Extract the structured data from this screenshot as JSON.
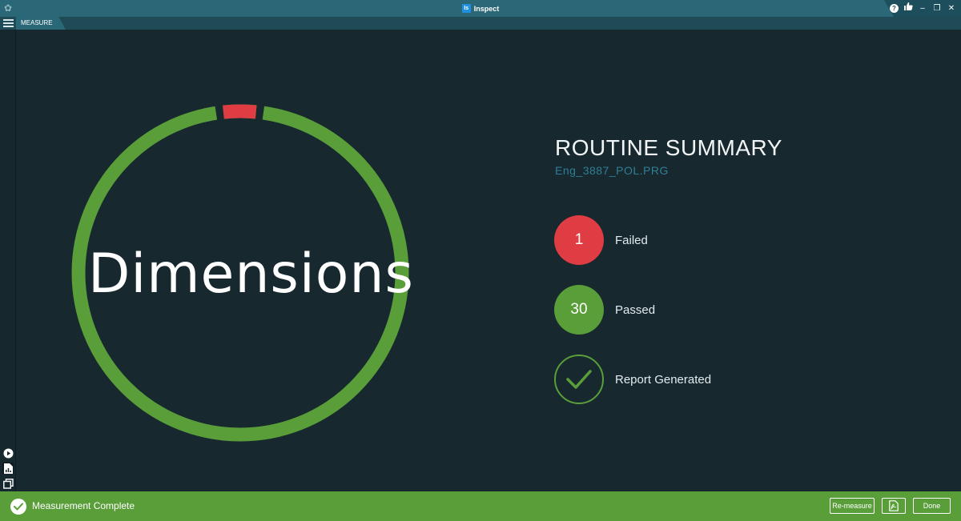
{
  "window": {
    "app_icon_text": "Is",
    "title": "Inspect",
    "controls": [
      "help-icon",
      "thumbs-up-icon",
      "minimize-icon",
      "restore-icon",
      "close-icon"
    ]
  },
  "tabs": [
    {
      "label": "MEASURE",
      "active": true
    }
  ],
  "sidebar": {
    "items": [
      "play-icon",
      "report-icon",
      "pages-icon"
    ]
  },
  "ring": {
    "title": "Dimensions",
    "passed_color": "#5a9e3a",
    "failed_color": "#e03c44"
  },
  "summary": {
    "title": "ROUTINE SUMMARY",
    "file": "Eng_3887_POL.PRG",
    "failed": {
      "count": "1",
      "label": "Failed"
    },
    "passed": {
      "count": "30",
      "label": "Passed"
    },
    "report": {
      "label": "Report Generated"
    }
  },
  "statusbar": {
    "text": "Measurement Complete",
    "buttons": {
      "remeasure": "Re-measure",
      "pdf": "pdf-icon",
      "done": "Done"
    },
    "background": "#5a9e3a"
  }
}
